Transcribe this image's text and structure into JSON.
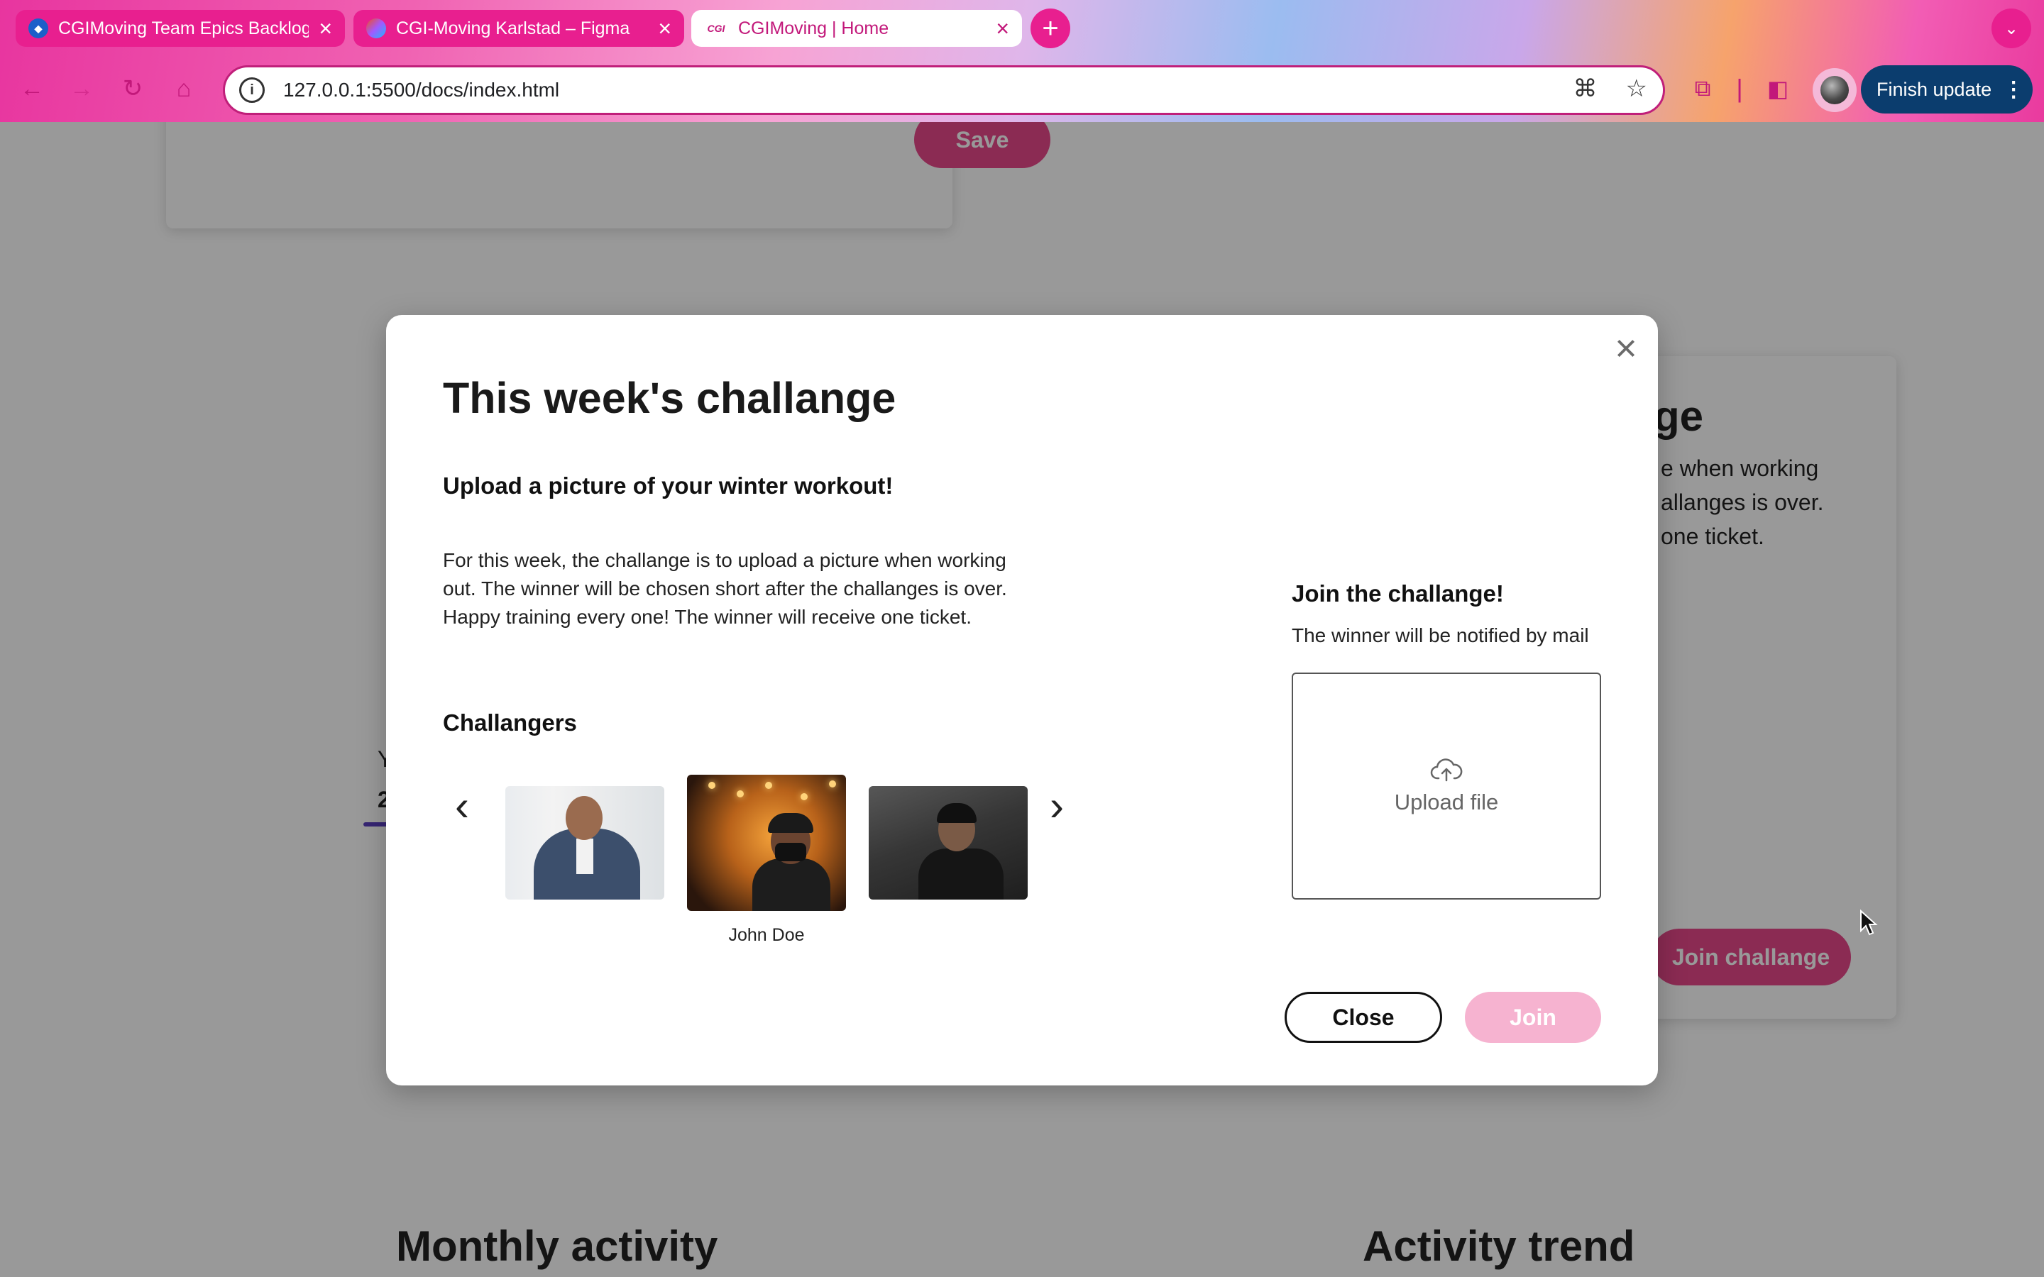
{
  "browser": {
    "tabs": [
      {
        "title": "CGIMoving Team Epics Backlog",
        "favicon": "azure-boards-icon"
      },
      {
        "title": "CGI-Moving Karlstad – Figma",
        "favicon": "figma-icon"
      },
      {
        "title": "CGIMoving | Home",
        "favicon_text": "CGI",
        "active": true
      }
    ],
    "url": "127.0.0.1:5500/docs/index.html",
    "finish_update_label": "Finish update"
  },
  "background": {
    "save_label": "Save",
    "right_card_title_fragment": "ge",
    "right_card_text_fragment": "e when working allanges is over. one ticket.",
    "join_challenge_label": "Join challange",
    "left_fragment_y": "Y",
    "left_fragment_2": "2",
    "monthly_activity_heading": "Monthly activity",
    "activity_trend_heading": "Activity trend"
  },
  "modal": {
    "title": "This week's challange",
    "subtitle": "Upload a picture of your winter workout!",
    "description": "For this week, the challange is to upload a picture when working out. The winner will be chosen short after the challanges is over. Happy training every one! The winner will receive one ticket.",
    "challengers_heading": "Challangers",
    "challengers": [
      {
        "name": ""
      },
      {
        "name": "John Doe",
        "selected": true
      },
      {
        "name": ""
      }
    ],
    "join_heading": "Join the challange!",
    "join_note": "The winner will be notified by mail",
    "upload_label": "Upload file",
    "close_label": "Close",
    "join_label": "Join"
  },
  "colors": {
    "accent_pink": "#e8488a",
    "join_disabled": "#f6b3d0",
    "update_button": "#0b3d6e",
    "overlay": "rgba(0,0,0,0.4)"
  }
}
